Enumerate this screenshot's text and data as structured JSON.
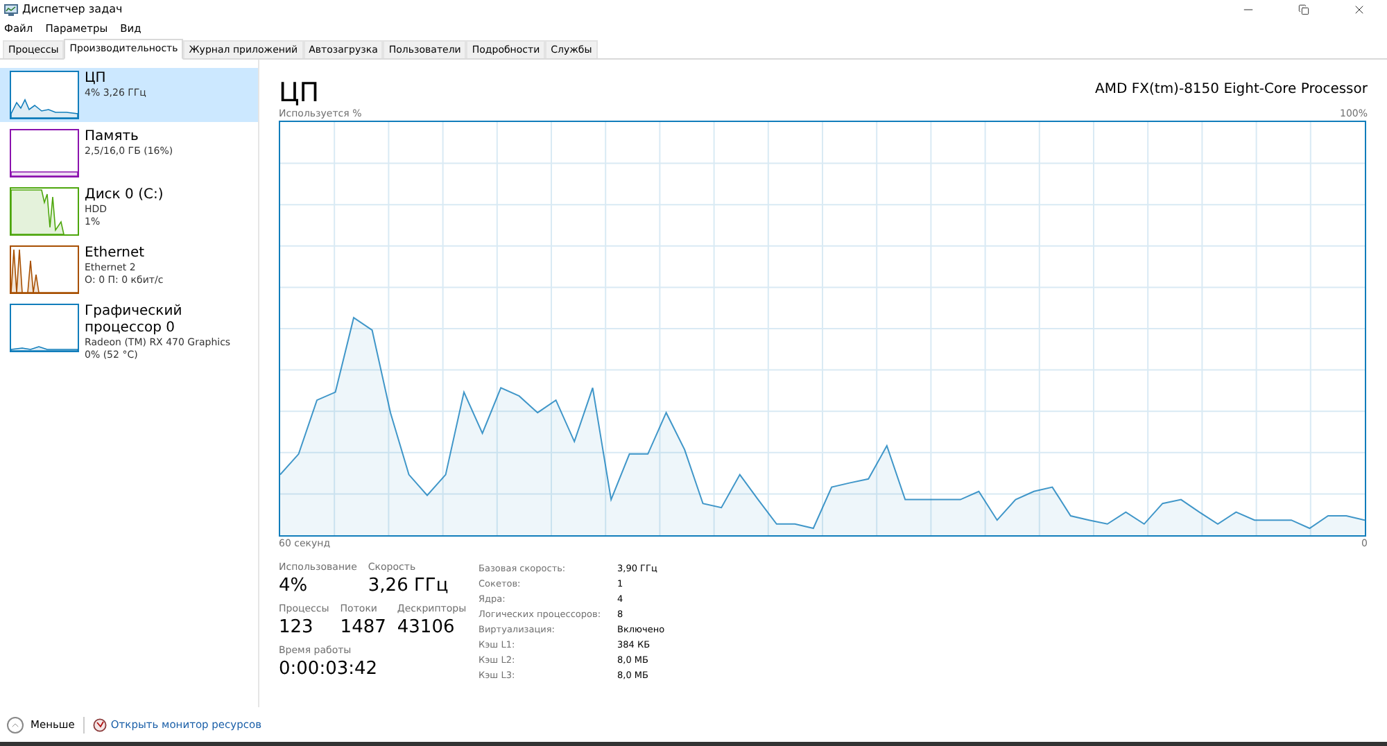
{
  "window": {
    "title": "Диспетчер задач"
  },
  "menu": [
    "Файл",
    "Параметры",
    "Вид"
  ],
  "tabs": [
    {
      "label": "Процессы",
      "selected": false
    },
    {
      "label": "Производительность",
      "selected": true
    },
    {
      "label": "Журнал приложений",
      "selected": false
    },
    {
      "label": "Автозагрузка",
      "selected": false
    },
    {
      "label": "Пользователи",
      "selected": false
    },
    {
      "label": "Подробности",
      "selected": false
    },
    {
      "label": "Службы",
      "selected": false
    }
  ],
  "sidebar": {
    "items": [
      {
        "kind": "cpu",
        "name": "ЦП",
        "lines": [
          "4% 3,26 ГГц"
        ],
        "color": "#117dbb",
        "selected": true
      },
      {
        "kind": "memory",
        "name": "Память",
        "lines": [
          "2,5/16,0 ГБ (16%)"
        ],
        "color": "#8b12ae",
        "selected": false
      },
      {
        "kind": "disk",
        "name": "Диск 0 (C:)",
        "lines": [
          "HDD",
          "1%"
        ],
        "color": "#4da60c",
        "selected": false
      },
      {
        "kind": "ethernet",
        "name": "Ethernet",
        "lines": [
          "Ethernet 2",
          "О: 0 П: 0 кбит/с"
        ],
        "color": "#a74f01",
        "selected": false
      },
      {
        "kind": "gpu",
        "name": "Графический процессор 0",
        "lines": [
          "Radeon (TM) RX 470 Graphics",
          "0% (52 °C)"
        ],
        "color": "#117dbb",
        "selected": false
      }
    ]
  },
  "main": {
    "title": "ЦП",
    "device": "AMD FX(tm)-8150 Eight-Core Processor",
    "chart_data": {
      "type": "area",
      "ylabel": "Используется %",
      "xlabel": "60 секунд",
      "grid": true,
      "ylim": [
        0,
        100
      ],
      "yticks": [
        {
          "value": 0,
          "label": "0"
        },
        {
          "value": 100,
          "label": "100%"
        }
      ],
      "series": [
        {
          "color": "#117dbb",
          "values": [
            16.2,
            21.0,
            33.5,
            35.4,
            52.7,
            49.8,
            30.6,
            16.2,
            11.4,
            16.2,
            35.4,
            25.8,
            36.4,
            34.5,
            30.6,
            33.5,
            23.9,
            36.4,
            10.4,
            21.0,
            21.0,
            30.6,
            22.0,
            9.5,
            8.5,
            16.2,
            10.4,
            4.7,
            4.7,
            3.7,
            13.3,
            14.3,
            15.2,
            22.9,
            10.4,
            10.4,
            10.4,
            10.4,
            12.3,
            5.6,
            10.4,
            12.3,
            13.3,
            6.6,
            5.6,
            4.7,
            7.5,
            4.7,
            9.5,
            10.4,
            7.5,
            4.7,
            7.5,
            5.6,
            5.6,
            5.6,
            3.7,
            6.6,
            6.6,
            5.6
          ]
        }
      ]
    },
    "stats": [
      [
        {
          "label": "Использование",
          "value": "4%"
        },
        {
          "label": "Скорость",
          "value": "3,26 ГГц"
        }
      ],
      [
        {
          "label": "Процессы",
          "value": "123"
        },
        {
          "label": "Потоки",
          "value": "1487"
        },
        {
          "label": "Дескрипторы",
          "value": "43106"
        }
      ],
      [
        {
          "label": "Время работы",
          "value": "0:00:03:42"
        }
      ]
    ],
    "details": [
      {
        "label": "Базовая скорость:",
        "value": "3,90 ГГц"
      },
      {
        "label": "Сокетов:",
        "value": "1"
      },
      {
        "label": "Ядра:",
        "value": "4"
      },
      {
        "label": "Логических процессоров:",
        "value": "8"
      },
      {
        "label": "Виртуализация:",
        "value": "Включено"
      },
      {
        "label": "Кэш L1:",
        "value": "384 КБ"
      },
      {
        "label": "Кэш L2:",
        "value": "8,0 МБ"
      },
      {
        "label": "Кэш L3:",
        "value": "8,0 МБ"
      }
    ]
  },
  "footer": {
    "less": "Меньше",
    "link": "Открыть монитор ресурсов"
  }
}
